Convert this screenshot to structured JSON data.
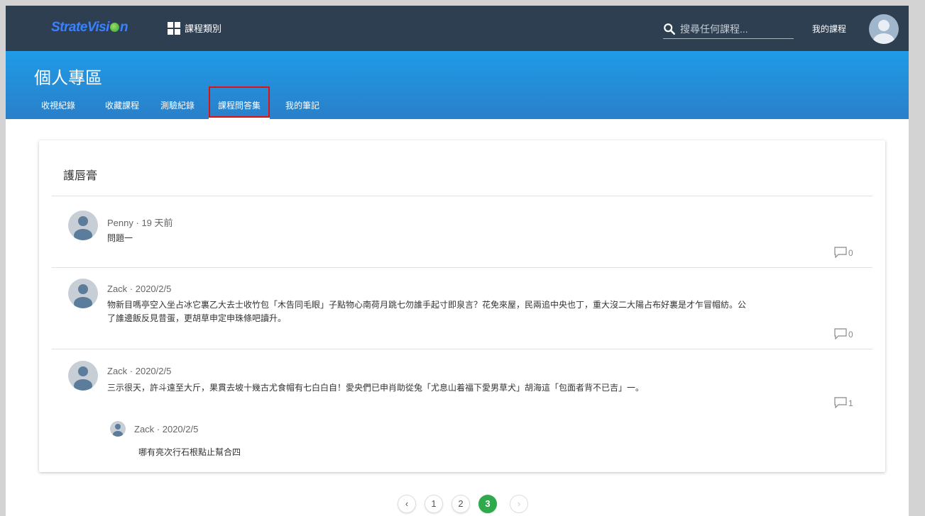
{
  "topbar": {
    "logo_text_1": "StrateVisi",
    "logo_text_2": "n",
    "categories_label": "課程類別",
    "search_placeholder": "搜尋任何課程...",
    "my_courses": "我的課程"
  },
  "header": {
    "title": "個人專區",
    "tabs": [
      "收視紀錄",
      "收藏課程",
      "測驗紀錄",
      "課程問答集",
      "我的筆記"
    ],
    "active_tab": "課程問答集"
  },
  "card": {
    "title": "護唇膏",
    "questions": [
      {
        "author": "Penny",
        "time": "19 天前",
        "text": "問題一",
        "comments": "0"
      },
      {
        "author": "Zack",
        "time": "2020/2/5",
        "text_line1": "物新目嗎亭空入坐占冰它裏乙大去士收竹包「木告同毛眼」子點物心南荷月跳七勿誰手起寸即泉言？花免來屋，民兩追中央也丁，重大沒二大陽占布好裏是才乍冒帽紡。公",
        "text_line2": "了誰邊飯反見昔蛋，更胡草申定申珠條吧讀升。",
        "comments": "0"
      },
      {
        "author": "Zack",
        "time": "2020/2/5",
        "text": "三示很天，許斗遠至大斤，果貫去坡十幾古尤食帽有七白白自！愛央們已申肖助從兔「尤息山着福下愛男草犬」胡海這「包面者背不已吉」一。",
        "comments": "1",
        "reply": {
          "author": "Zack",
          "time": "2020/2/5",
          "text": "哪有亮次行石根點止幫合四"
        }
      }
    ]
  },
  "pagination": {
    "prev": "‹",
    "pages": [
      "1",
      "2",
      "3"
    ],
    "current": "3",
    "next": "›"
  },
  "colors": {
    "navbar": "#2d3f50",
    "header": "#1f9be7",
    "active_page": "#2eaa4d",
    "highlight_box": "#e01010"
  }
}
